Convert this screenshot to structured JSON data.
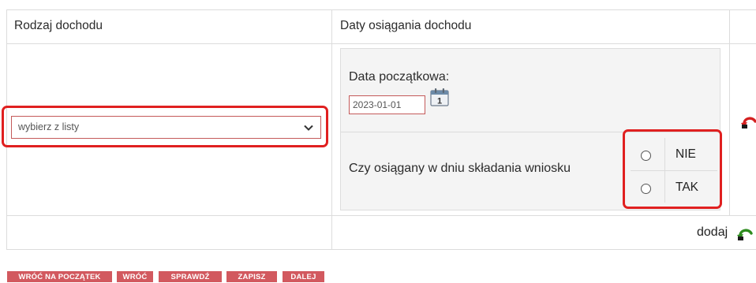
{
  "table": {
    "headers": [
      "Rodzaj dochodu",
      "Daty osiągania dochodu"
    ],
    "income_type_select": {
      "value": "wybierz z listy"
    },
    "start_date": {
      "label": "Data początkowa:",
      "value": "2023-01-01"
    },
    "question": "Czy osiągany w dniu składania wniosku",
    "radio_options": [
      "NIE",
      "TAK"
    ],
    "add_label": "dodaj"
  },
  "buttons": [
    "WRÓĆ NA POCZĄTEK",
    "WRÓĆ",
    "SPRAWDŹ",
    "ZAPISZ",
    "DALEJ"
  ],
  "colors": {
    "button_bg": "#d2595f",
    "highlight": "#e02020",
    "input_border": "#c45a5a"
  },
  "icons": [
    "chevron-down-icon",
    "calendar-icon",
    "remove-undo-icon",
    "add-undo-icon"
  ]
}
